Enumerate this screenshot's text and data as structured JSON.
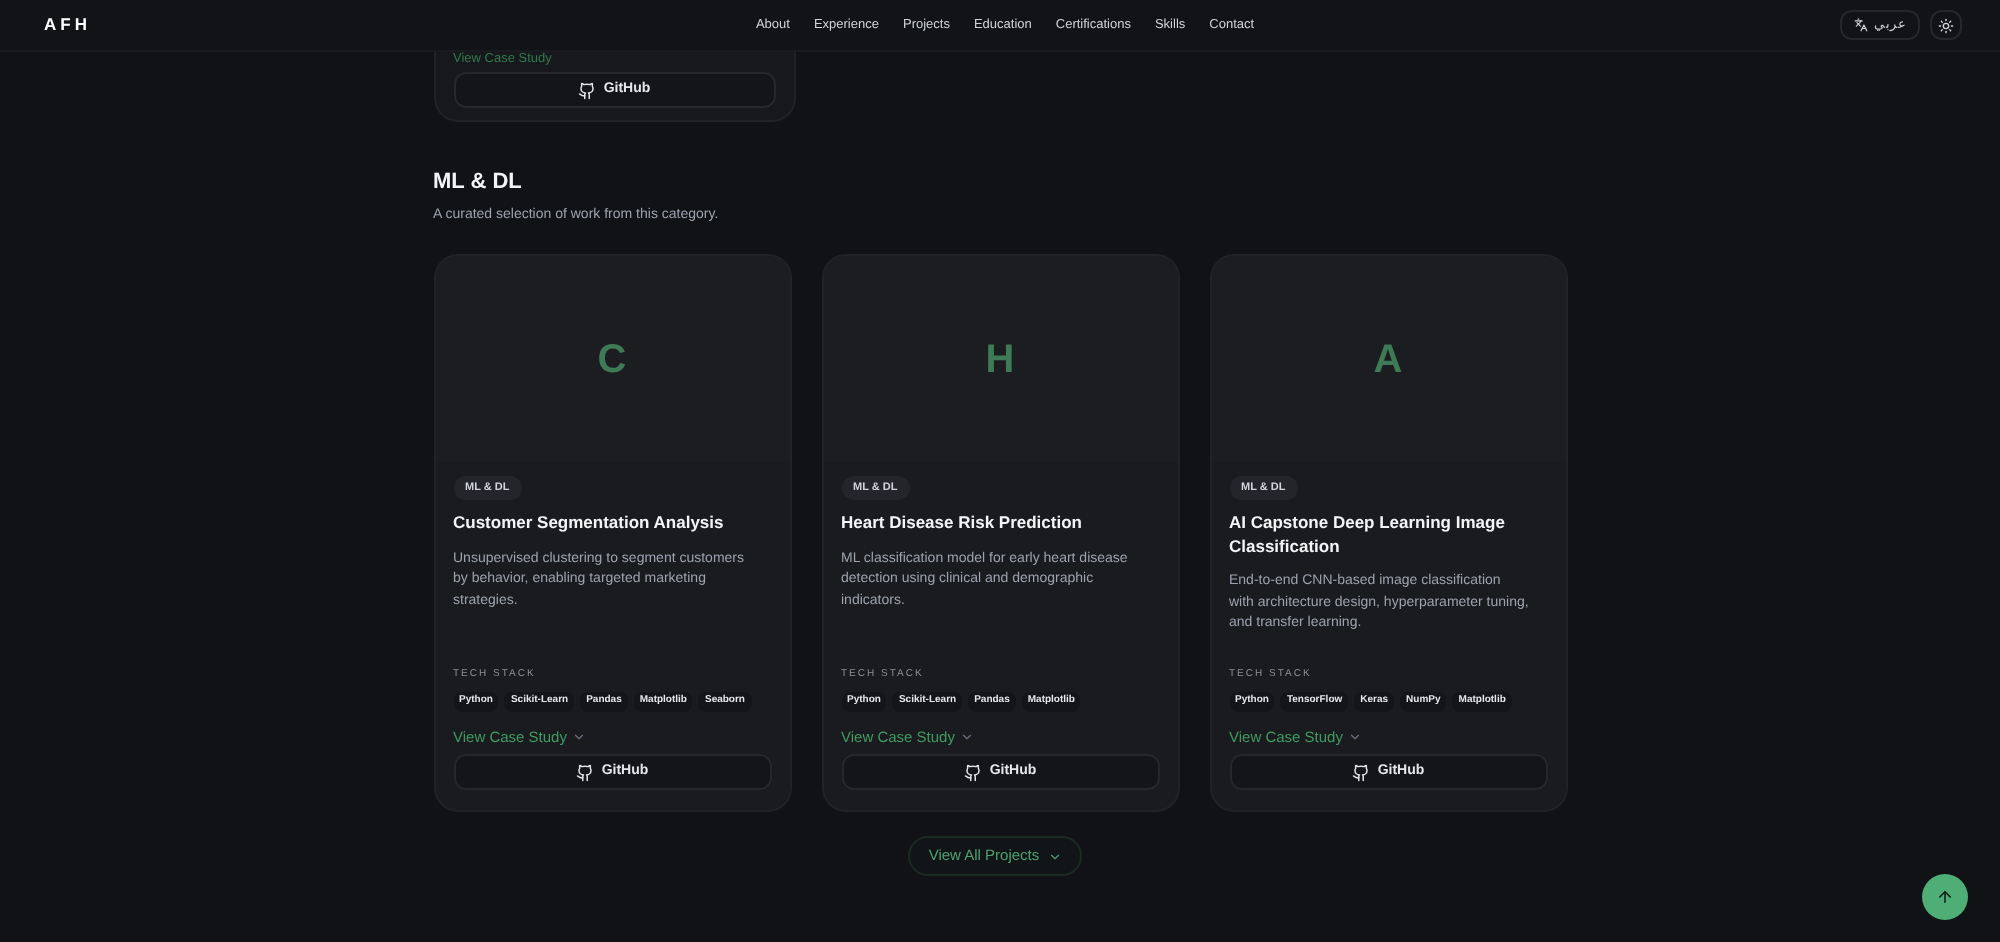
{
  "nav": {
    "logo": "AFH",
    "links": [
      "About",
      "Experience",
      "Projects",
      "Education",
      "Certifications",
      "Skills",
      "Contact"
    ],
    "language": "عربي"
  },
  "previous_card": {
    "case_study": "View Case Study",
    "github": "GitHub"
  },
  "section": {
    "title": "ML & DL",
    "subtitle": "A curated selection of work from this category."
  },
  "projects": [
    {
      "initial": "C",
      "tag": "ML & DL",
      "title": "Customer Segmentation Analysis",
      "description": "Unsupervised clustering to segment customers by behavior, enabling targeted marketing strategies.",
      "stack_label": "TECH STACK",
      "stack": [
        "Python",
        "Scikit-Learn",
        "Pandas",
        "Matplotlib",
        "Seaborn"
      ],
      "case_study": "View Case Study",
      "github": "GitHub"
    },
    {
      "initial": "H",
      "tag": "ML & DL",
      "title": "Heart Disease Risk Prediction",
      "description": "ML classification model for early heart disease detection using clinical and demographic indicators.",
      "stack_label": "TECH STACK",
      "stack": [
        "Python",
        "Scikit-Learn",
        "Pandas",
        "Matplotlib"
      ],
      "case_study": "View Case Study",
      "github": "GitHub"
    },
    {
      "initial": "A",
      "tag": "ML & DL",
      "title": "AI Capstone Deep Learning Image Classification",
      "description": "End-to-end CNN-based image classification with architecture design, hyperparameter tuning, and transfer learning.",
      "stack_label": "TECH STACK",
      "stack": [
        "Python",
        "TensorFlow",
        "Keras",
        "NumPy",
        "Matplotlib"
      ],
      "case_study": "View Case Study",
      "github": "GitHub"
    }
  ],
  "view_all": "View All Projects"
}
